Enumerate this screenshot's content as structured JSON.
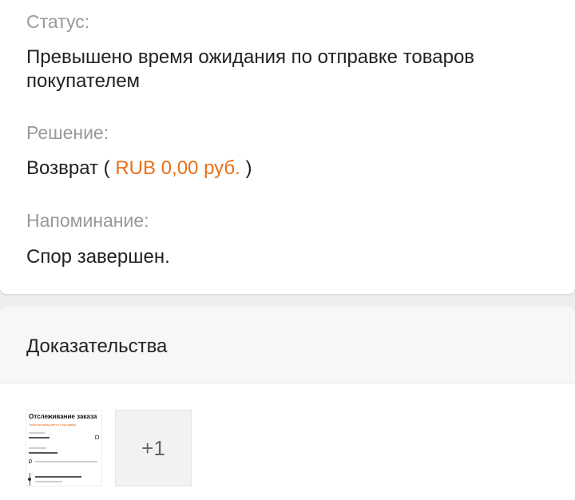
{
  "status": {
    "label": "Статус:",
    "value_line1": "Превышено время ожидания по отправке товаров",
    "value_line2": "покупателем"
  },
  "decision": {
    "label": "Решение:",
    "prefix": "Возврат (",
    "amount": "RUB 0,00 руб.",
    "suffix": ")"
  },
  "reminder": {
    "label": "Напоминание:",
    "value": "Спор завершен."
  },
  "evidence": {
    "title": "Доказательства",
    "thumbnail_title": "Отслеживание заказа",
    "thumbnail_subtitle": "Заказ возвращается к продавцу",
    "more_count": "+1"
  },
  "colors": {
    "accent": "#e8701a",
    "label_gray": "#999999",
    "text": "#222222"
  }
}
